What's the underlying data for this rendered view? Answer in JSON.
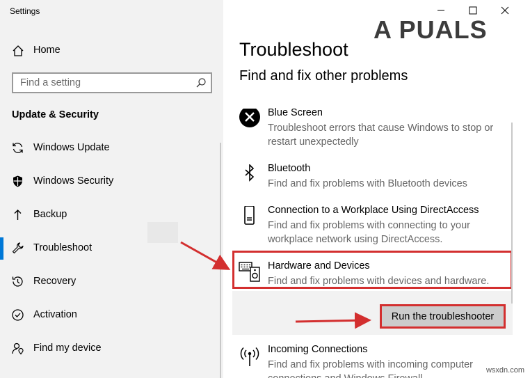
{
  "window": {
    "title": "Settings"
  },
  "watermark_brand": "A  PUALS",
  "sidebar": {
    "home_label": "Home",
    "search_placeholder": "Find a setting",
    "section_title": "Update & Security",
    "items": [
      {
        "label": "Windows Update",
        "icon": "refresh-icon"
      },
      {
        "label": "Windows Security",
        "icon": "shield-icon"
      },
      {
        "label": "Backup",
        "icon": "backup-arrow-icon"
      },
      {
        "label": "Troubleshoot",
        "icon": "wrench-icon",
        "active": true
      },
      {
        "label": "Recovery",
        "icon": "history-icon"
      },
      {
        "label": "Activation",
        "icon": "check-circle-icon"
      },
      {
        "label": "Find my device",
        "icon": "person-location-icon"
      }
    ]
  },
  "main": {
    "title": "Troubleshoot",
    "subtitle": "Find and fix other problems",
    "items": [
      {
        "name": "Blue Screen",
        "desc": "Troubleshoot errors that cause Windows to stop or restart unexpectedly",
        "icon": "x-circle-icon"
      },
      {
        "name": "Bluetooth",
        "desc": "Find and fix problems with Bluetooth devices",
        "icon": "bluetooth-icon"
      },
      {
        "name": "Connection to a Workplace Using DirectAccess",
        "desc": "Find and fix problems with connecting to your workplace network using DirectAccess.",
        "icon": "phone-device-icon"
      },
      {
        "name": "Hardware and Devices",
        "desc": "Find and fix problems with devices and hardware.",
        "icon": "keyboard-speaker-icon"
      },
      {
        "name": "Incoming Connections",
        "desc": "Find and fix problems with incoming computer connections and Windows Firewall.",
        "icon": "antenna-icon"
      }
    ],
    "run_button": "Run the troubleshooter"
  },
  "source_watermark": "wsxdn.com",
  "colors": {
    "accent": "#0078d7",
    "highlight": "#d32f2f",
    "sidebar_bg": "#f2f2f2"
  }
}
